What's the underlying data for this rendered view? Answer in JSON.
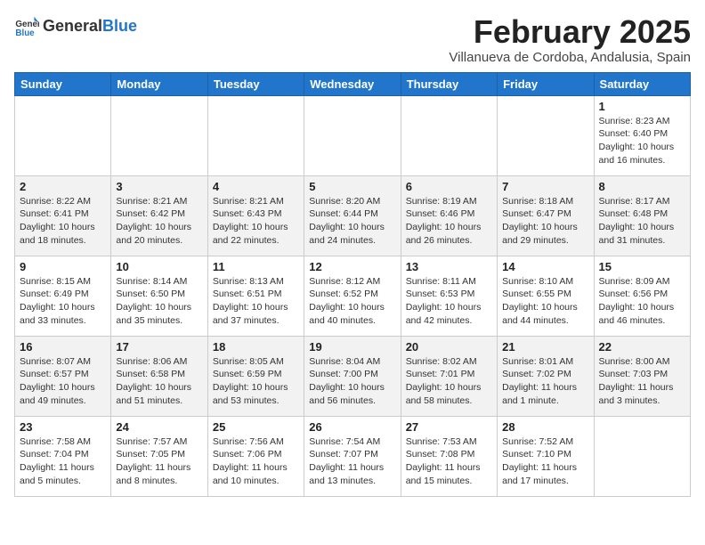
{
  "header": {
    "logo_general": "General",
    "logo_blue": "Blue",
    "month_title": "February 2025",
    "subtitle": "Villanueva de Cordoba, Andalusia, Spain"
  },
  "weekdays": [
    "Sunday",
    "Monday",
    "Tuesday",
    "Wednesday",
    "Thursday",
    "Friday",
    "Saturday"
  ],
  "weeks": [
    [
      {
        "day": "",
        "info": ""
      },
      {
        "day": "",
        "info": ""
      },
      {
        "day": "",
        "info": ""
      },
      {
        "day": "",
        "info": ""
      },
      {
        "day": "",
        "info": ""
      },
      {
        "day": "",
        "info": ""
      },
      {
        "day": "1",
        "info": "Sunrise: 8:23 AM\nSunset: 6:40 PM\nDaylight: 10 hours\nand 16 minutes."
      }
    ],
    [
      {
        "day": "2",
        "info": "Sunrise: 8:22 AM\nSunset: 6:41 PM\nDaylight: 10 hours\nand 18 minutes."
      },
      {
        "day": "3",
        "info": "Sunrise: 8:21 AM\nSunset: 6:42 PM\nDaylight: 10 hours\nand 20 minutes."
      },
      {
        "day": "4",
        "info": "Sunrise: 8:21 AM\nSunset: 6:43 PM\nDaylight: 10 hours\nand 22 minutes."
      },
      {
        "day": "5",
        "info": "Sunrise: 8:20 AM\nSunset: 6:44 PM\nDaylight: 10 hours\nand 24 minutes."
      },
      {
        "day": "6",
        "info": "Sunrise: 8:19 AM\nSunset: 6:46 PM\nDaylight: 10 hours\nand 26 minutes."
      },
      {
        "day": "7",
        "info": "Sunrise: 8:18 AM\nSunset: 6:47 PM\nDaylight: 10 hours\nand 29 minutes."
      },
      {
        "day": "8",
        "info": "Sunrise: 8:17 AM\nSunset: 6:48 PM\nDaylight: 10 hours\nand 31 minutes."
      }
    ],
    [
      {
        "day": "9",
        "info": "Sunrise: 8:15 AM\nSunset: 6:49 PM\nDaylight: 10 hours\nand 33 minutes."
      },
      {
        "day": "10",
        "info": "Sunrise: 8:14 AM\nSunset: 6:50 PM\nDaylight: 10 hours\nand 35 minutes."
      },
      {
        "day": "11",
        "info": "Sunrise: 8:13 AM\nSunset: 6:51 PM\nDaylight: 10 hours\nand 37 minutes."
      },
      {
        "day": "12",
        "info": "Sunrise: 8:12 AM\nSunset: 6:52 PM\nDaylight: 10 hours\nand 40 minutes."
      },
      {
        "day": "13",
        "info": "Sunrise: 8:11 AM\nSunset: 6:53 PM\nDaylight: 10 hours\nand 42 minutes."
      },
      {
        "day": "14",
        "info": "Sunrise: 8:10 AM\nSunset: 6:55 PM\nDaylight: 10 hours\nand 44 minutes."
      },
      {
        "day": "15",
        "info": "Sunrise: 8:09 AM\nSunset: 6:56 PM\nDaylight: 10 hours\nand 46 minutes."
      }
    ],
    [
      {
        "day": "16",
        "info": "Sunrise: 8:07 AM\nSunset: 6:57 PM\nDaylight: 10 hours\nand 49 minutes."
      },
      {
        "day": "17",
        "info": "Sunrise: 8:06 AM\nSunset: 6:58 PM\nDaylight: 10 hours\nand 51 minutes."
      },
      {
        "day": "18",
        "info": "Sunrise: 8:05 AM\nSunset: 6:59 PM\nDaylight: 10 hours\nand 53 minutes."
      },
      {
        "day": "19",
        "info": "Sunrise: 8:04 AM\nSunset: 7:00 PM\nDaylight: 10 hours\nand 56 minutes."
      },
      {
        "day": "20",
        "info": "Sunrise: 8:02 AM\nSunset: 7:01 PM\nDaylight: 10 hours\nand 58 minutes."
      },
      {
        "day": "21",
        "info": "Sunrise: 8:01 AM\nSunset: 7:02 PM\nDaylight: 11 hours\nand 1 minute."
      },
      {
        "day": "22",
        "info": "Sunrise: 8:00 AM\nSunset: 7:03 PM\nDaylight: 11 hours\nand 3 minutes."
      }
    ],
    [
      {
        "day": "23",
        "info": "Sunrise: 7:58 AM\nSunset: 7:04 PM\nDaylight: 11 hours\nand 5 minutes."
      },
      {
        "day": "24",
        "info": "Sunrise: 7:57 AM\nSunset: 7:05 PM\nDaylight: 11 hours\nand 8 minutes."
      },
      {
        "day": "25",
        "info": "Sunrise: 7:56 AM\nSunset: 7:06 PM\nDaylight: 11 hours\nand 10 minutes."
      },
      {
        "day": "26",
        "info": "Sunrise: 7:54 AM\nSunset: 7:07 PM\nDaylight: 11 hours\nand 13 minutes."
      },
      {
        "day": "27",
        "info": "Sunrise: 7:53 AM\nSunset: 7:08 PM\nDaylight: 11 hours\nand 15 minutes."
      },
      {
        "day": "28",
        "info": "Sunrise: 7:52 AM\nSunset: 7:10 PM\nDaylight: 11 hours\nand 17 minutes."
      },
      {
        "day": "",
        "info": ""
      }
    ]
  ]
}
